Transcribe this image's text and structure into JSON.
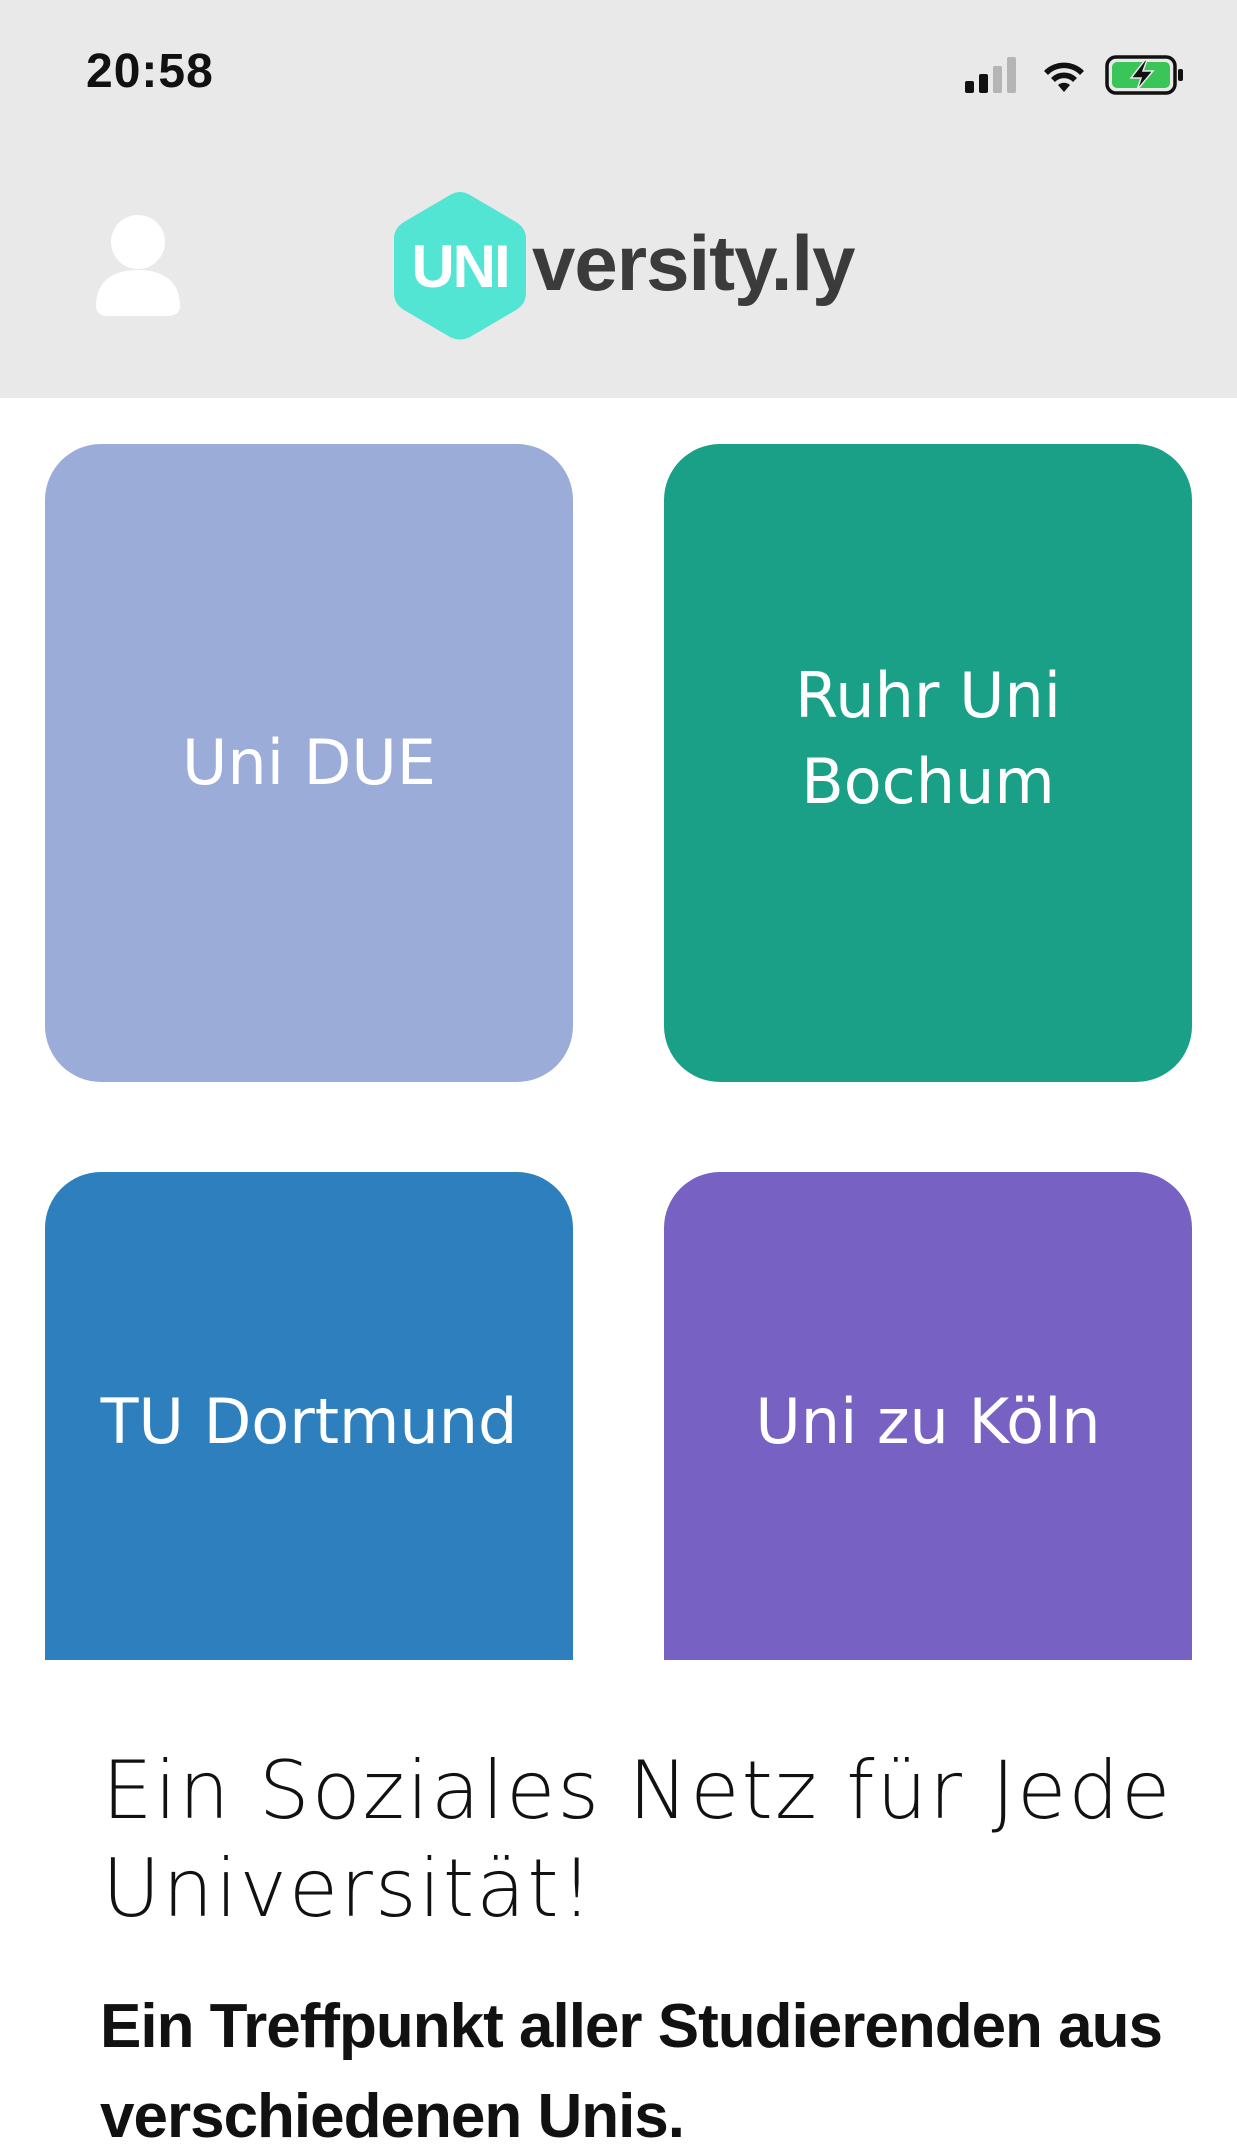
{
  "status_bar": {
    "time": "20:58",
    "icons": [
      "cellular-signal-icon",
      "wifi-icon",
      "battery-charging-icon"
    ]
  },
  "header": {
    "profile_icon": "user-icon",
    "logo": {
      "badge": "UNI",
      "text": "versity.ly",
      "badge_color": "#52e5d4"
    }
  },
  "universities": [
    {
      "label": "Uni DUE",
      "color": "#9aacd7"
    },
    {
      "label": "Ruhr Uni Bochum",
      "color": "#1aa086"
    },
    {
      "label": "TU Dortmund",
      "color": "#2d80bd"
    },
    {
      "label": "Uni zu Köln",
      "color": "#7761c3"
    }
  ],
  "tagline": {
    "headline": "Ein Soziales Netz für Jede Universität!",
    "subline": "Ein Treffpunkt aller Studierenden aus verschiedenen Unis."
  }
}
